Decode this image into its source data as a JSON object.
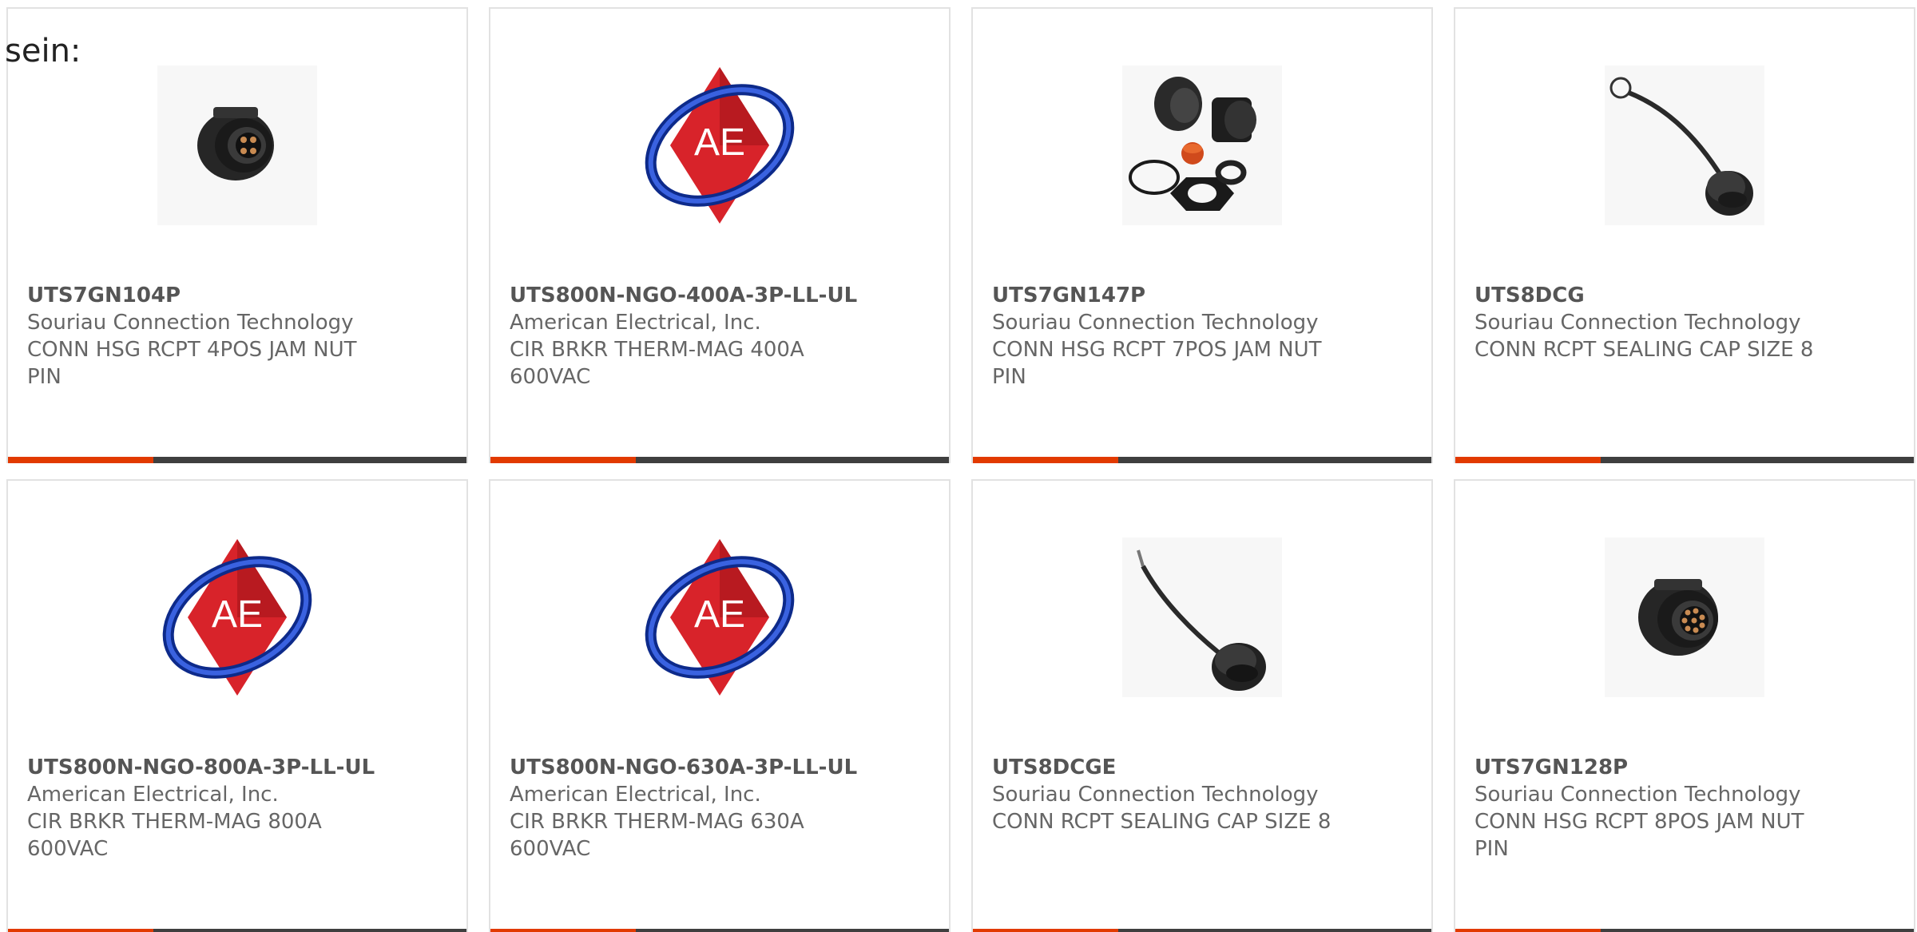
{
  "intro_text": "sein:",
  "colors": {
    "accent": "#e23a00",
    "bar": "#3f3f3f",
    "ae_red": "#d8232a",
    "ae_blue": "#1f3fae"
  },
  "products": [
    {
      "part_number": "UTS7GN104P",
      "manufacturer": "Souriau Connection Technology",
      "description": "CONN HSG RCPT 4POS JAM NUT PIN",
      "image": "connector-receptacle-image"
    },
    {
      "part_number": "UTS800N-NGO-400A-3P-LL-UL",
      "manufacturer": "American Electrical, Inc.",
      "description": "CIR BRKR THERM-MAG 400A 600VAC",
      "image": "american-electrical-logo",
      "logo_text": "AE"
    },
    {
      "part_number": "UTS7GN147P",
      "manufacturer": "Souriau Connection Technology",
      "description": "CONN HSG RCPT 7POS JAM NUT PIN",
      "image": "connector-kit-image"
    },
    {
      "part_number": "UTS8DCG",
      "manufacturer": "Souriau Connection Technology",
      "description": "CONN RCPT SEALING CAP SIZE 8",
      "image": "sealing-cap-ring-image"
    },
    {
      "part_number": "UTS800N-NGO-800A-3P-LL-UL",
      "manufacturer": "American Electrical, Inc.",
      "description": "CIR BRKR THERM-MAG 800A 600VAC",
      "image": "american-electrical-logo",
      "logo_text": "AE"
    },
    {
      "part_number": "UTS800N-NGO-630A-3P-LL-UL",
      "manufacturer": "American Electrical, Inc.",
      "description": "CIR BRKR THERM-MAG 630A 600VAC",
      "image": "american-electrical-logo",
      "logo_text": "AE"
    },
    {
      "part_number": "UTS8DCGE",
      "manufacturer": "Souriau Connection Technology",
      "description": "CONN RCPT SEALING CAP SIZE 8",
      "image": "sealing-cap-lanyard-image"
    },
    {
      "part_number": "UTS7GN128P",
      "manufacturer": "Souriau Connection Technology",
      "description": "CONN HSG RCPT 8POS JAM NUT PIN",
      "image": "connector-receptacle-8pin-image"
    }
  ]
}
